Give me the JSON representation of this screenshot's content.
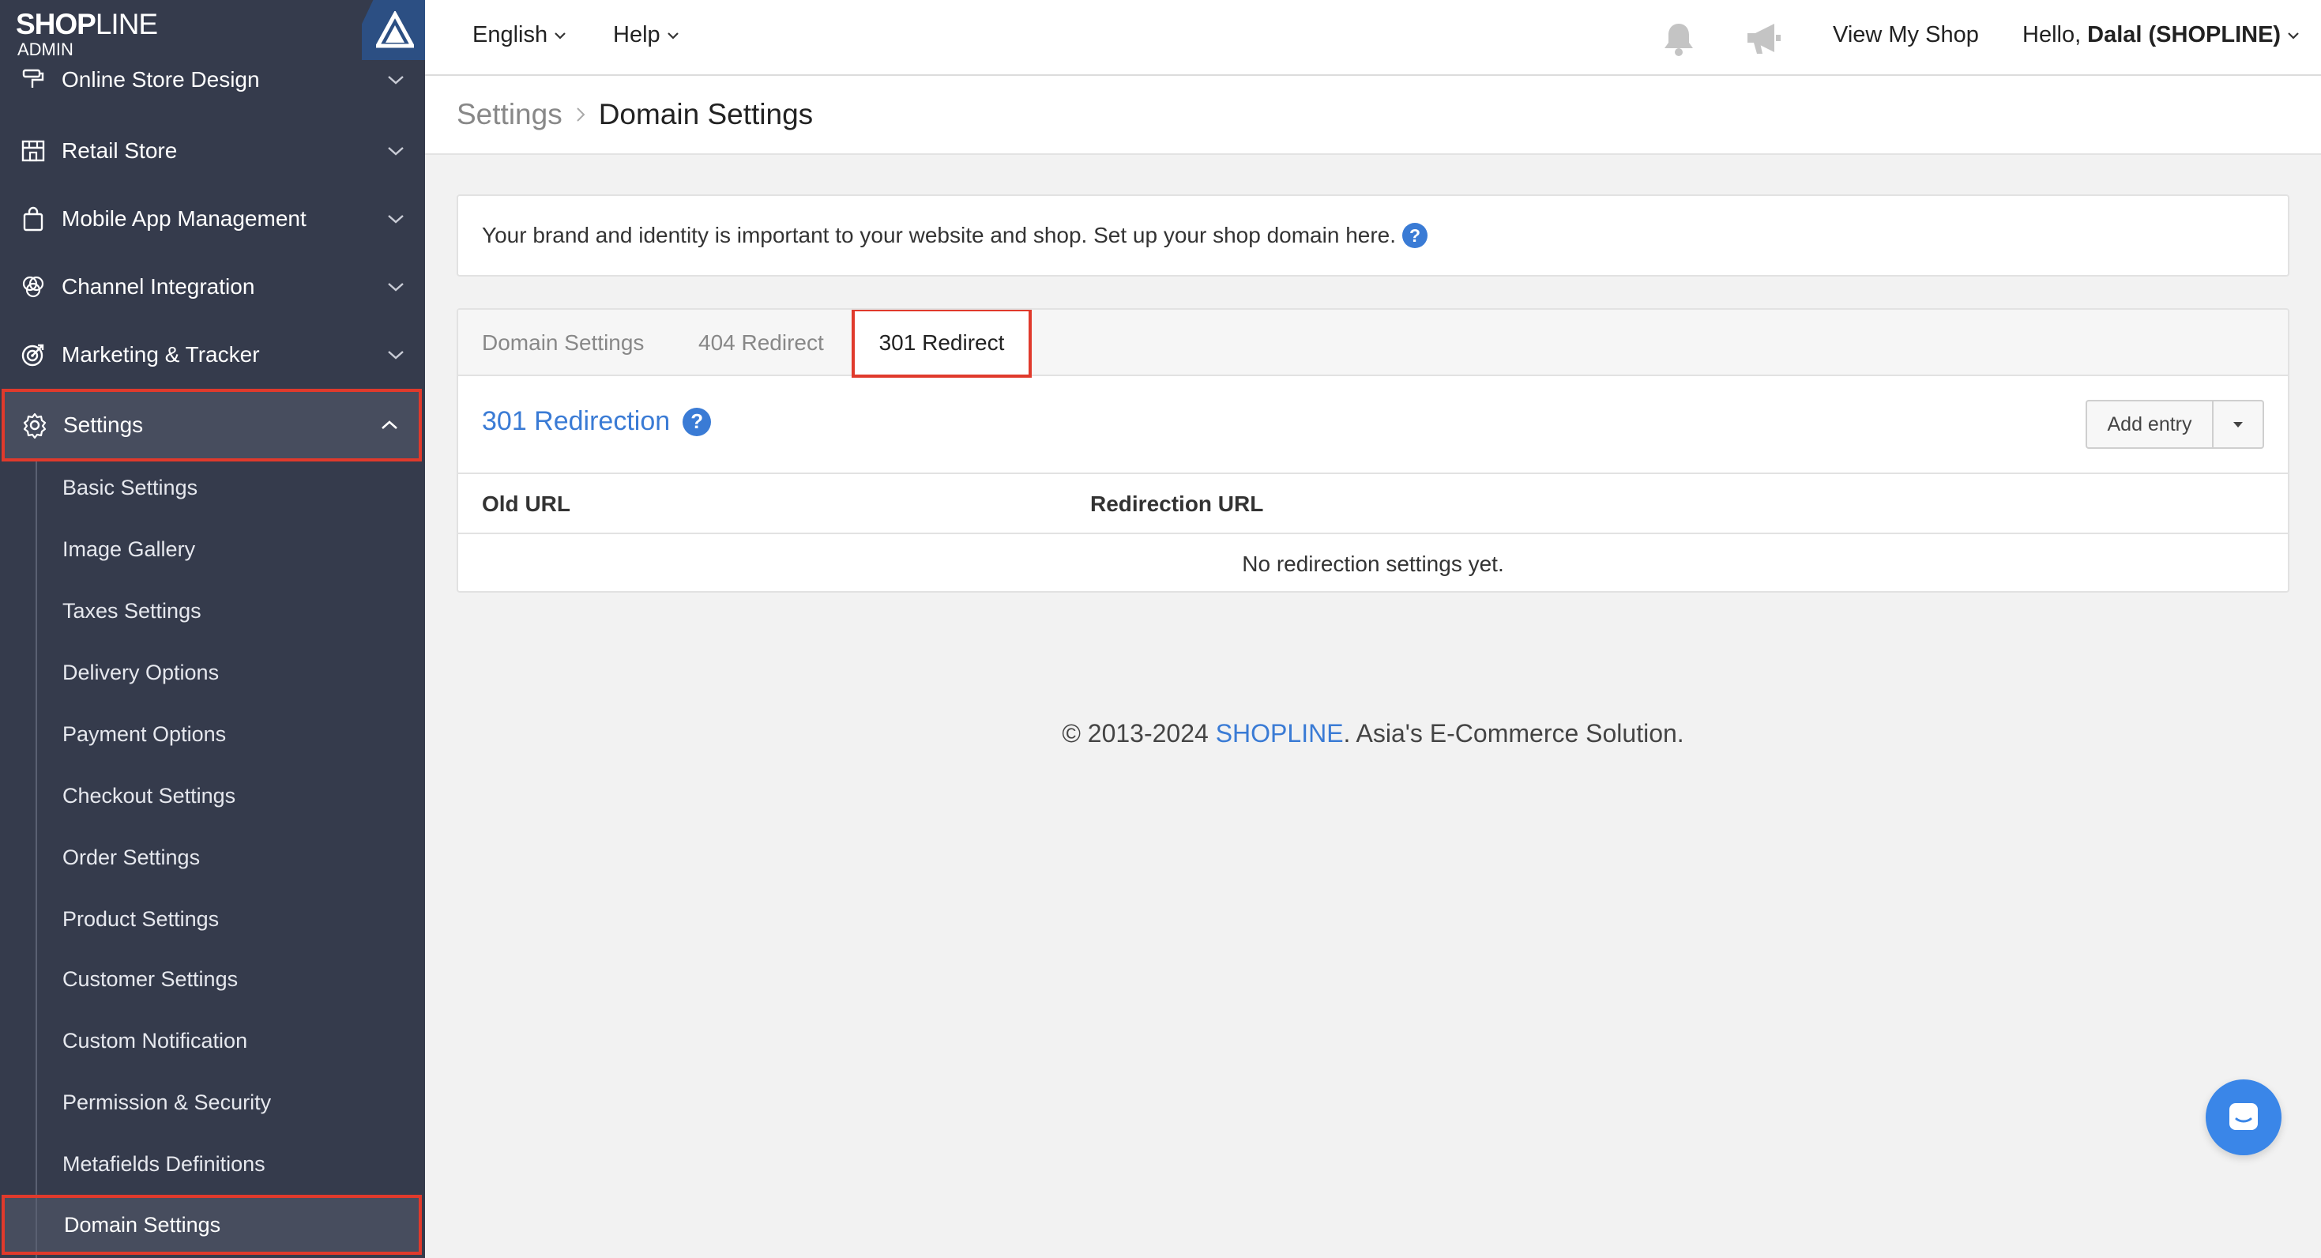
{
  "brand": {
    "logo_main": "SHOP",
    "logo_thin": "LINE",
    "logo_sub": "ADMIN"
  },
  "sidebar": {
    "items": [
      {
        "label": "Online Store Design",
        "icon": "paint-roller-icon"
      },
      {
        "label": "Retail Store",
        "icon": "store-icon"
      },
      {
        "label": "Mobile App Management",
        "icon": "shopping-bag-icon"
      },
      {
        "label": "Channel Integration",
        "icon": "channels-icon"
      },
      {
        "label": "Marketing & Tracker",
        "icon": "target-icon"
      },
      {
        "label": "Settings",
        "icon": "gear-icon"
      }
    ],
    "sub_items": [
      "Basic Settings",
      "Image Gallery",
      "Taxes Settings",
      "Delivery Options",
      "Payment Options",
      "Checkout Settings",
      "Order Settings",
      "Product Settings",
      "Customer Settings",
      "Custom Notification",
      "Permission & Security",
      "Metafields Definitions",
      "Domain Settings"
    ]
  },
  "header": {
    "language": "English",
    "help": "Help",
    "view_shop": "View My Shop",
    "greeting": "Hello,",
    "user": "Dalal (SHOPLINE)"
  },
  "breadcrumb": {
    "parent": "Settings",
    "current": "Domain Settings"
  },
  "info": {
    "text": "Your brand and identity is important to your website and shop. Set up your shop domain here."
  },
  "tabs": [
    "Domain Settings",
    "404 Redirect",
    "301 Redirect"
  ],
  "section": {
    "title": "301 Redirection",
    "add_button": "Add entry"
  },
  "table": {
    "columns": [
      "Old URL",
      "Redirection URL"
    ],
    "empty_message": "No redirection settings yet."
  },
  "footer": {
    "prefix": "© 2013-2024 ",
    "brand": "SHOPLINE",
    "suffix": ". Asia's E-Commerce Solution."
  },
  "colors": {
    "sidebar_bg": "#353b4c",
    "accent_blue": "#3a7bd5",
    "highlight_red": "#e03a2c"
  }
}
